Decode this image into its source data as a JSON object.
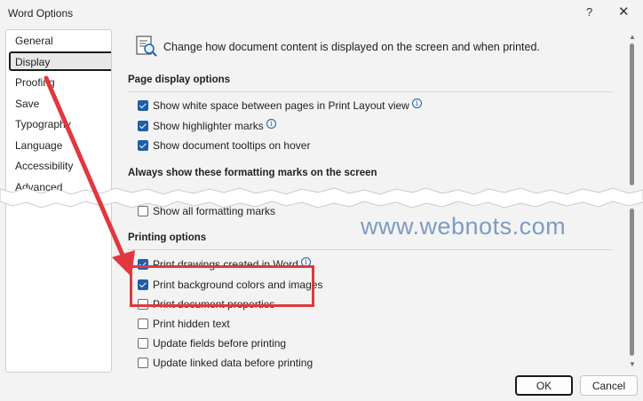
{
  "window": {
    "title": "Word Options",
    "help_glyph": "?",
    "close_glyph": "✕"
  },
  "sidebar": {
    "items": [
      {
        "label": "General",
        "selected": false
      },
      {
        "label": "Display",
        "selected": true
      },
      {
        "label": "Proofing",
        "selected": false
      },
      {
        "label": "Save",
        "selected": false
      },
      {
        "label": "Typography",
        "selected": false
      },
      {
        "label": "Language",
        "selected": false
      },
      {
        "label": "Accessibility",
        "selected": false
      },
      {
        "label": "Advanced",
        "selected": false
      }
    ]
  },
  "content": {
    "header": {
      "icon": "display-settings-icon",
      "text": "Change how document content is displayed on the screen and when printed."
    },
    "page_display": {
      "title": "Page display options",
      "options": [
        {
          "label": "Show white space between pages in Print Layout view",
          "checked": true,
          "info": true
        },
        {
          "label": "Show highlighter marks",
          "checked": true,
          "info": true
        },
        {
          "label": "Show document tooltips on hover",
          "checked": true,
          "info": false
        }
      ]
    },
    "formatting_marks": {
      "title": "Always show these formatting marks on the screen",
      "options": [
        {
          "label": "Show all formatting marks",
          "checked": false,
          "info": false
        }
      ]
    },
    "printing": {
      "title": "Printing options",
      "options": [
        {
          "label": "Print drawings created in Word",
          "checked": true,
          "info": true
        },
        {
          "label": "Print background colors and images",
          "checked": true,
          "info": false
        },
        {
          "label": "Print document properties",
          "checked": false,
          "info": false
        },
        {
          "label": "Print hidden text",
          "checked": false,
          "info": false
        },
        {
          "label": "Update fields before printing",
          "checked": false,
          "info": false
        },
        {
          "label": "Update linked data before printing",
          "checked": false,
          "info": false
        }
      ]
    }
  },
  "watermark": "www.webnots.com",
  "buttons": {
    "ok": "OK",
    "cancel": "Cancel"
  },
  "annotation": {
    "highlight_color": "#e0383e",
    "arrow_color": "#e0383e"
  },
  "colors": {
    "checkbox_accent": "#1d5fa6",
    "watermark": "#7d9cc2"
  }
}
